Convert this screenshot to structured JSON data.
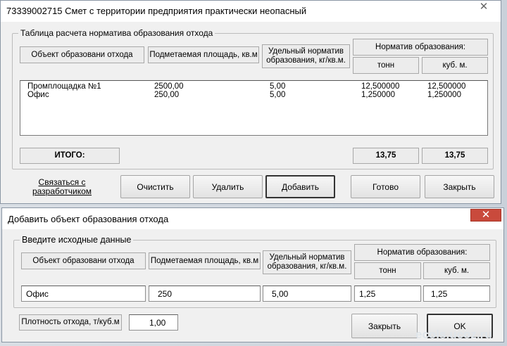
{
  "win1": {
    "title": "73339002715 Смет с территории предприятия практически неопасный",
    "close_glyph": "✕",
    "group_title": "Таблица расчета норматива образования отхода",
    "headers": {
      "object": "Объект образовани отхода",
      "area": "Подметаемая площадь, кв.м",
      "norm": "Удельный норматив образования, кг/кв.м.",
      "normative": "Норматив образования:",
      "tons": "тонн",
      "cubic": "куб. м."
    },
    "rows": [
      {
        "name": "Промплощадка №1",
        "area": "2500,00",
        "norm": "5,00",
        "tons": "12,500000",
        "cubic": "12,500000"
      },
      {
        "name": "Офис",
        "area": "250,00",
        "norm": "5,00",
        "tons": "1,250000",
        "cubic": "1,250000"
      }
    ],
    "total_label": "ИТОГО:",
    "total_tons": "13,75",
    "total_cubic": "13,75",
    "contact_link": "Связаться с разработчиком",
    "buttons": {
      "clear": "Очистить",
      "delete": "Удалить",
      "add": "Добавить",
      "done": "Готово",
      "close": "Закрыть"
    }
  },
  "win2": {
    "title": "Добавить объект образования отхода",
    "close_glyph": "✕",
    "group_title": "Введите исходные данные",
    "headers": {
      "object": "Объект образовани отхода",
      "area": "Подметаемая площадь, кв.м",
      "norm": "Удельный норматив образования, кг/кв.м.",
      "normative": "Норматив образования:",
      "tons": "тонн",
      "cubic": "куб. м."
    },
    "fields": {
      "name": "Офис",
      "area": "250",
      "norm": "5,00",
      "tons": "1,25",
      "cubic": "1,25"
    },
    "density_label": "Плотность отхода, т/куб.м",
    "density_value": "1,00",
    "buttons": {
      "close": "Закрыть",
      "ok": "OK"
    }
  },
  "watermark": "ecols.ucoz.ru"
}
